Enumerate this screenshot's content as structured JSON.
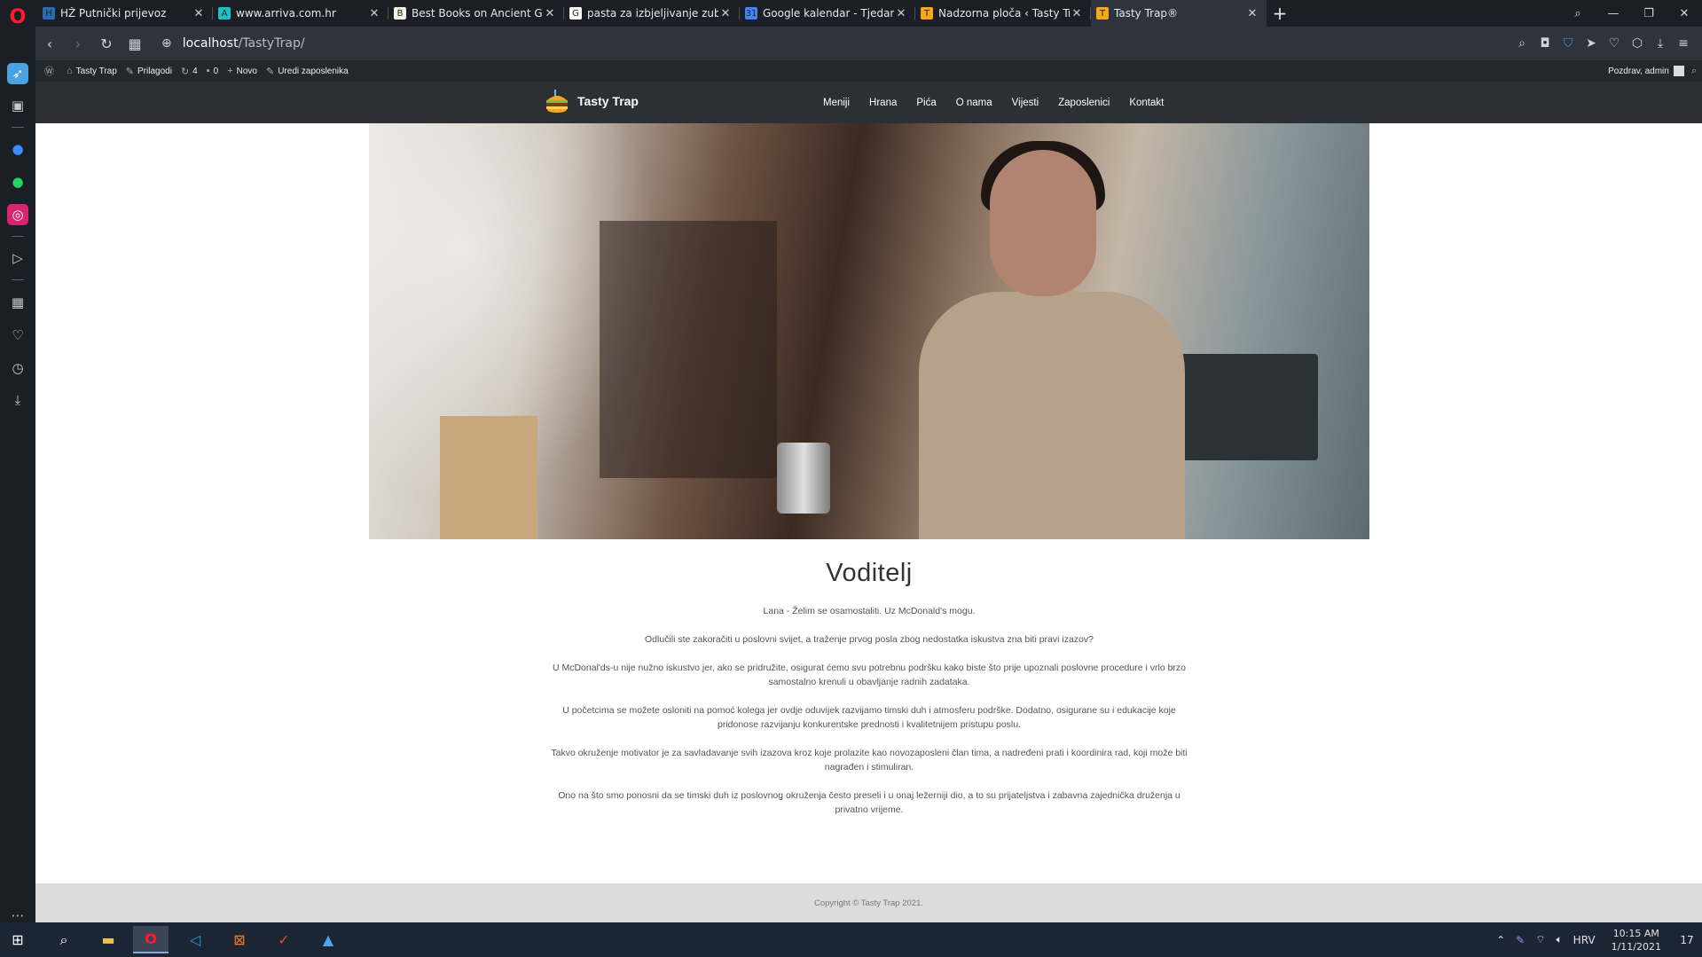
{
  "browser": {
    "tabs": [
      {
        "title": "HŽ Putnički prijevoz",
        "favicon_color": "#2b6cb0",
        "favicon_glyph": "H"
      },
      {
        "title": "www.arriva.com.hr",
        "favicon_color": "#1ec0c8",
        "favicon_glyph": "A"
      },
      {
        "title": "Best Books on Ancient Gre",
        "favicon_color": "#f3f0e6",
        "favicon_glyph": "B"
      },
      {
        "title": "pasta za izbjeljivanje zubi -",
        "favicon_color": "#ffffff",
        "favicon_glyph": "G"
      },
      {
        "title": "Google kalendar - Tjedan o",
        "favicon_color": "#4285f4",
        "favicon_glyph": "31"
      },
      {
        "title": "Nadzorna ploča ‹ Tasty Tra",
        "favicon_color": "#f6a623",
        "favicon_glyph": "T"
      },
      {
        "title": "Tasty Trap®",
        "favicon_color": "#f6a623",
        "favicon_glyph": "T",
        "active": true
      }
    ],
    "new_tab_glyph": "+",
    "url_host": "localhost",
    "url_path": "/TastyTrap/"
  },
  "wp_admin_bar": {
    "site_name": "Tasty Trap",
    "customize": "Prilagodi",
    "updates_count": "4",
    "comments_count": "0",
    "new": "Novo",
    "edit": "Uredi zaposlenika",
    "greeting": "Pozdrav, admin"
  },
  "site": {
    "brand_name": "Tasty Trap",
    "menu": [
      "Meniji",
      "Hrana",
      "Pića",
      "O nama",
      "Vijesti",
      "Zaposlenici",
      "Kontakt"
    ]
  },
  "content": {
    "heading": "Voditelj",
    "paragraphs": [
      "Lana - Želim se osamostaliti. Uz McDonald's mogu.",
      "Odlučili ste zakoračiti u poslovni svijet, a traženje prvog posla zbog nedostatka iskustva zna biti pravi izazov?",
      "U McDonal'ds-u nije nužno iskustvo jer, ako se pridružite, osigurat ćemo svu potrebnu podršku kako biste što prije upoznali poslovne procedure i vrlo brzo samostalno krenuli u obavljanje radnih zadataka.",
      "U početcima se možete osloniti na pomoć kolega jer ovdje oduvijek razvijamo timski duh i atmosferu podrške. Dodatno, osigurane su i edukacije koje pridonose razvijanju konkurentske prednosti i kvalitetnijem pristupu poslu.",
      "Takvo okruženje motivator je za savladavanje svih izazova kroz koje prolazite kao novozaposleni član tima, a nadređeni prati i koordinira rad, koji može biti nagrađen i stimuliran.",
      "Ono na što smo ponosni da se timski duh iz poslovnog okruženja često preseli i u onaj ležerniji dio, a to su prijateljstva i zabavna zajednička druženja u privatno vrijeme."
    ]
  },
  "footer": {
    "copyright": "Copyright © Tasty Trap 2021."
  },
  "taskbar": {
    "language": "HRV",
    "time": "10:15 AM",
    "date": "1/11/2021",
    "notification_count": "17"
  },
  "colors": {
    "accent_opera": "#ff1b2d",
    "wp_bar": "#23282d",
    "site_header": "#2c2f33",
    "footer_bg": "#dcdcdc"
  }
}
